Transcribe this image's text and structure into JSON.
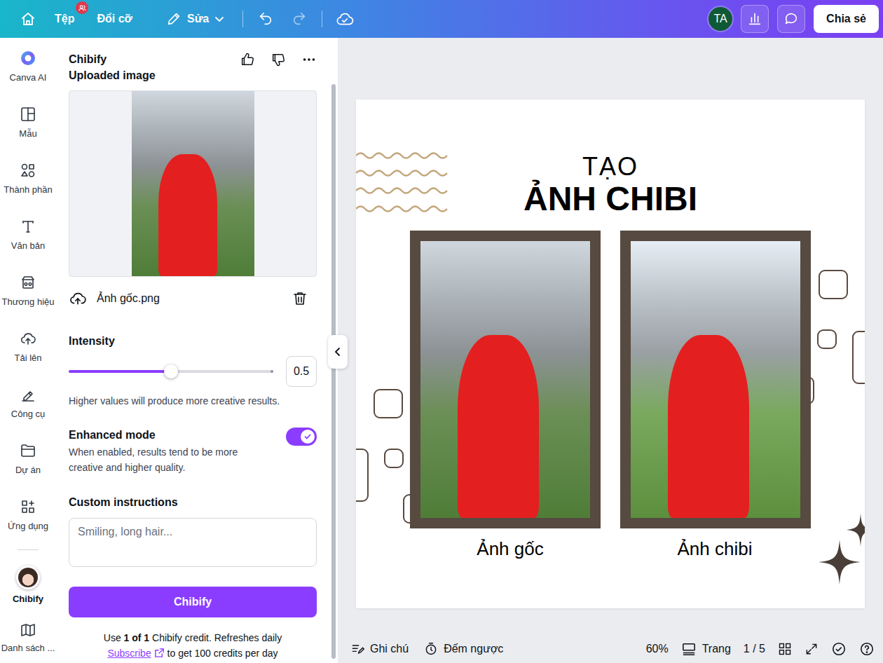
{
  "topbar": {
    "menu": [
      {
        "label": "Tệp",
        "badge": true
      },
      {
        "label": "Đổi cỡ",
        "badge": false
      }
    ],
    "edit": {
      "label": "Sửa"
    },
    "avatar": "TA",
    "share": "Chia sẻ"
  },
  "rail": {
    "items": [
      {
        "label": "Canva AI",
        "selected": false
      },
      {
        "label": "Mẫu",
        "selected": false
      },
      {
        "label": "Thành phần",
        "selected": false
      },
      {
        "label": "Văn bản",
        "selected": false
      },
      {
        "label": "Thương hiệu",
        "selected": false
      },
      {
        "label": "Tải lên",
        "selected": false
      },
      {
        "label": "Công cụ",
        "selected": false
      },
      {
        "label": "Dự án",
        "selected": false
      },
      {
        "label": "Ứng dụng",
        "selected": false
      }
    ],
    "apps": [
      {
        "label": "Chibify",
        "selected": true
      },
      {
        "label": "Danh sách ...",
        "selected": false
      }
    ]
  },
  "panel": {
    "title": "Chibify",
    "subtitle": "Uploaded image",
    "file": "Ảnh gốc.png",
    "intensity": {
      "label": "Intensity",
      "level": 0.5,
      "value": "0.5",
      "hint": "Higher values will produce more creative results."
    },
    "enhanced": {
      "label": "Enhanced mode",
      "on": true,
      "hint": "When enabled, results tend to be more creative and higher quality."
    },
    "custom": {
      "label": "Custom instructions",
      "placeholder": "Smiling, long hair..."
    },
    "button": "Chibify",
    "footer": {
      "prefix": "Use ",
      "bold": "1 of 1",
      "suffix": " Chibify credit. Refreshes daily",
      "link": "Subscribe",
      "after": " to get 100 credits per day"
    }
  },
  "canvas": {
    "title_small": "TẠO",
    "title_big": "ẢNH CHIBI",
    "frames": [
      {
        "caption": "Ảnh gốc"
      },
      {
        "caption": "Ảnh chibi"
      }
    ]
  },
  "bottombar": {
    "notes": "Ghi chú",
    "timer": "Đếm ngược",
    "zoom": "60%",
    "pages_label": "Trang",
    "pages": "1 / 5"
  }
}
